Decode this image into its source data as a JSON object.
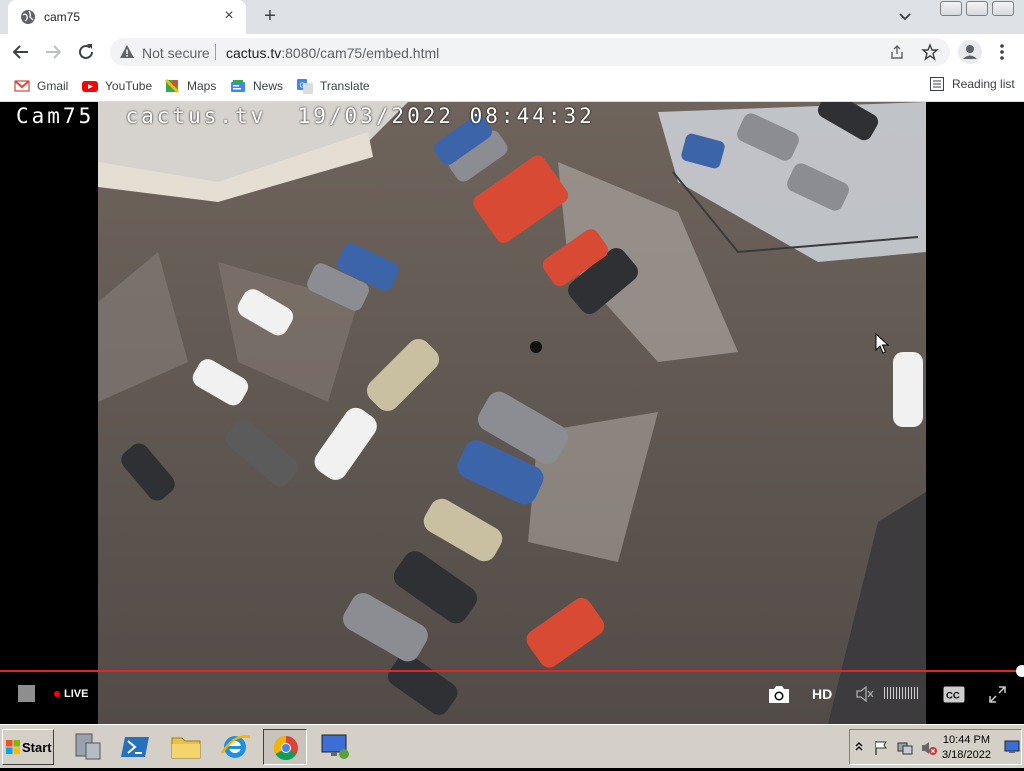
{
  "tab": {
    "title": "cam75",
    "close_glyph": "×",
    "new_tab_glyph": "+"
  },
  "toolbar": {
    "security_label": "Not secure",
    "url_host": "cactus.tv",
    "url_rest": ":8080/cam75/embed.html"
  },
  "bookmarks": [
    {
      "label": "Gmail",
      "icon": "gmail-icon"
    },
    {
      "label": "YouTube",
      "icon": "youtube-icon"
    },
    {
      "label": "Maps",
      "icon": "maps-icon"
    },
    {
      "label": "News",
      "icon": "news-icon"
    },
    {
      "label": "Translate",
      "icon": "translate-icon"
    }
  ],
  "reading_list_label": "Reading list",
  "video": {
    "overlay": "Cam75  cactus.tv  19/03/2022 08:44:32",
    "live_label": "LIVE",
    "hd_label": "HD",
    "cc_label": "CC",
    "progress": 1.0
  },
  "taskbar": {
    "start_label": "Start",
    "time": "10:44 PM",
    "date": "3/18/2022"
  },
  "colors": {
    "progress": "#e0262b",
    "live_dot": "#ff0000",
    "accent": "#1a73e8"
  }
}
